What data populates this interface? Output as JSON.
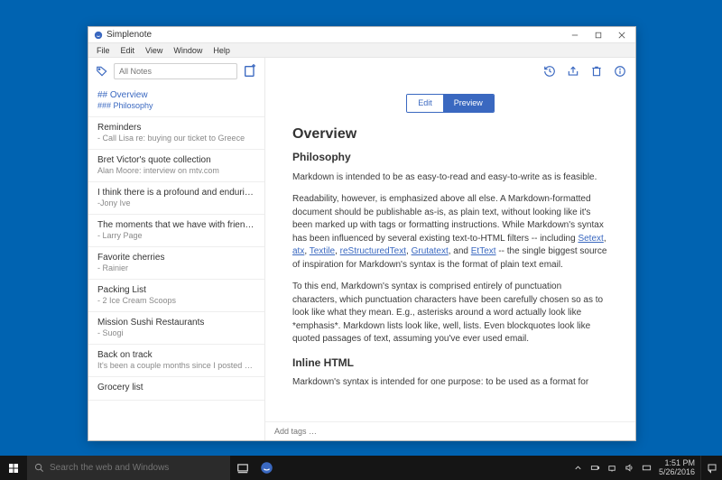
{
  "app": {
    "title": "Simplenote"
  },
  "menubar": {
    "items": [
      "File",
      "Edit",
      "View",
      "Window",
      "Help"
    ]
  },
  "sidebar": {
    "search_placeholder": "All Notes",
    "notes": [
      {
        "title": "## Overview",
        "sub": "### Philosophy",
        "selected": true
      },
      {
        "title": "Reminders",
        "sub": "- Call Lisa re: buying our ticket to Greece"
      },
      {
        "title": "Bret Victor's quote collection",
        "sub": "Alan Moore: interview on mtv.com"
      },
      {
        "title": "I think there is a profound and enduri…",
        "sub": "-Jony Ive"
      },
      {
        "title": "The moments that we have with friend…",
        "sub": "- Larry Page"
      },
      {
        "title": "Favorite cherries",
        "sub": "- Rainier"
      },
      {
        "title": "Packing List",
        "sub": "- 2 Ice Cream Scoops"
      },
      {
        "title": "Mission Sushi Restaurants",
        "sub": "- Suogi"
      },
      {
        "title": "Back on track",
        "sub": "It's been a couple months since I posted on …"
      },
      {
        "title": "Grocery list",
        "sub": ""
      }
    ]
  },
  "editor": {
    "toggle": {
      "edit": "Edit",
      "preview": "Preview",
      "active": "preview"
    },
    "h1": "Overview",
    "h2a": "Philosophy",
    "p1": "Markdown is intended to be as easy-to-read and easy-to-write as is feasible.",
    "p2_a": "Readability, however, is emphasized above all else. A Markdown-formatted document should be publishable as-is, as plain text, without looking like it's been marked up with tags or formatting instructions. While Markdown's syntax has been influenced by several existing text-to-HTML filters -- including ",
    "links": {
      "setext": "Setext",
      "atx": "atx",
      "textile": "Textile",
      "rst": "reStructuredText",
      "gruta": "Grutatext",
      "ettext": "EtText"
    },
    "p2_b": " -- the single biggest source of inspiration for Markdown's syntax is the format of plain text email.",
    "p3": "To this end, Markdown's syntax is comprised entirely of punctuation characters, which punctuation characters have been carefully chosen so as to look like what they mean. E.g., asterisks around a word actually look like *emphasis*. Markdown lists look like, well, lists. Even blockquotes look like quoted passages of text, assuming you've ever used email.",
    "h2b": "Inline HTML",
    "p4": "Markdown's syntax is intended for one purpose: to be used as a format for",
    "tag_placeholder": "Add tags …"
  },
  "taskbar": {
    "search_placeholder": "Search the web and Windows",
    "clock_time": "1:51 PM",
    "clock_date": "5/26/2016"
  }
}
